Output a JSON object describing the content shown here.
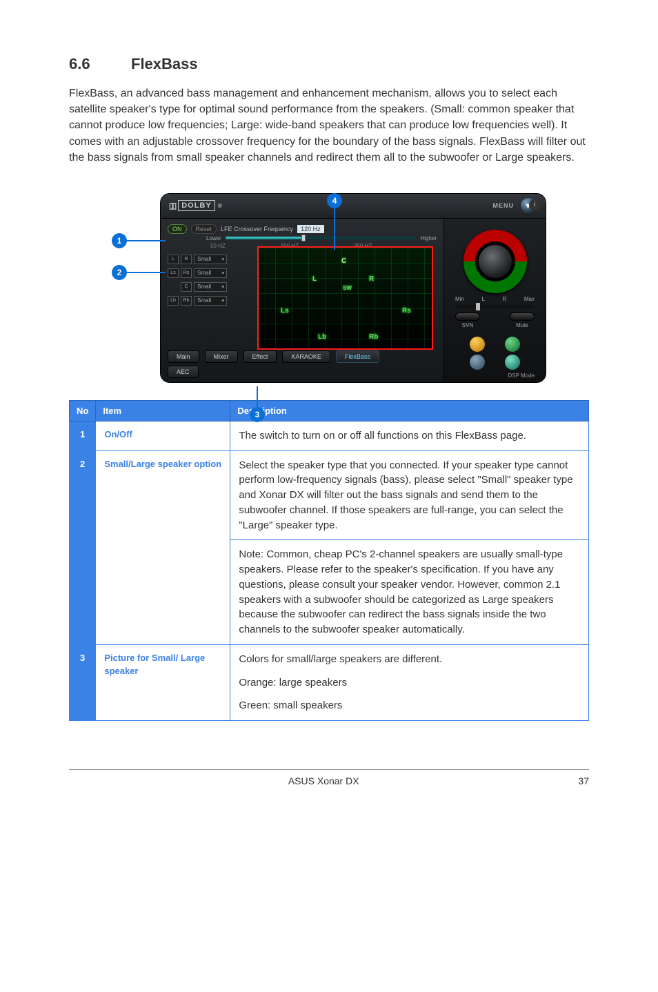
{
  "section": {
    "number": "6.6",
    "title": "FlexBass"
  },
  "intro": "FlexBass, an advanced bass management and enhancement mechanism, allows you to select each satellite speaker's type for optimal sound performance from the speakers. (Small: common speaker that cannot produce low frequencies; Large: wide-band speakers that can produce low frequencies well). It comes with an adjustable crossover frequency for the boundary of the bass signals. FlexBass will filter out the bass signals from small speaker channels and redirect them all to the subwoofer or Large speakers.",
  "markers": {
    "m1": "1",
    "m2": "2",
    "m3": "3",
    "m4": "4"
  },
  "app": {
    "titlebar": {
      "logo_prefix": "▯▯",
      "logo_box": "DOLBY",
      "reg": "®",
      "menu_label": "MENU",
      "menu_glyph": "▾"
    },
    "crossover": {
      "on": "ON",
      "reset": "Reset",
      "label": "LFE Crossover Frequency",
      "value": "120 Hz",
      "lower": "Lower",
      "higher": "Higher",
      "t1": "50 HZ",
      "t2": "150 HZ",
      "t3": "250 HZ"
    },
    "speaker_rows": [
      {
        "a": "L",
        "b": "R",
        "sel": "Small"
      },
      {
        "a": "Ls",
        "b": "Rs",
        "sel": "Small"
      },
      {
        "a": "",
        "b": "C",
        "sel": "Small"
      },
      {
        "a": "Lb",
        "b": "Rb",
        "sel": "Small"
      }
    ],
    "stage": {
      "L": "L",
      "R": "R",
      "C": "C",
      "SW": "SW",
      "Ls": "Ls",
      "Rs": "Rs",
      "Lb": "Lb",
      "Rb": "Rb"
    },
    "tabs": {
      "main": "Main",
      "mixer": "Mixer",
      "effect": "Effect",
      "karaoke": "KARAOKE",
      "flexbass": "FlexBass",
      "aec": "AEC"
    },
    "right": {
      "info": "i",
      "min": "Min",
      "L": "L",
      "R": "R",
      "max": "Max",
      "svn": "SVN",
      "mute": "Mute",
      "dsp": "DSP Mode"
    }
  },
  "table": {
    "headers": {
      "no": "No",
      "item": "Item",
      "desc": "Description"
    },
    "rows": [
      {
        "no": "1",
        "item": "On/Off",
        "desc": [
          "The switch to turn on or off all functions on this FlexBass page."
        ]
      },
      {
        "no": "2",
        "item": "Small/Large speaker option",
        "desc": [
          "Select the speaker type that you connected. If your speaker type cannot perform low-frequency signals (bass), please select \"Small\" speaker type and Xonar DX will filter out the bass signals and send them to the subwoofer channel. If those speakers are full-range, you can select the \"Large\" speaker type.",
          "Note: Common, cheap PC's 2-channel speakers are usually small-type speakers. Please refer to the speaker's specification. If you have any questions, please consult your speaker vendor. However, common 2.1 speakers with a subwoofer should be categorized as Large speakers because the subwoofer can redirect the bass signals inside the two channels to the subwoofer speaker automatically."
        ]
      },
      {
        "no": "3",
        "item": "Picture for Small/ Large speaker",
        "desc": [
          "Colors for small/large speakers are different.",
          "Orange: large speakers",
          "Green: small speakers"
        ]
      }
    ]
  },
  "footer": {
    "product": "ASUS Xonar DX",
    "page": "37"
  }
}
